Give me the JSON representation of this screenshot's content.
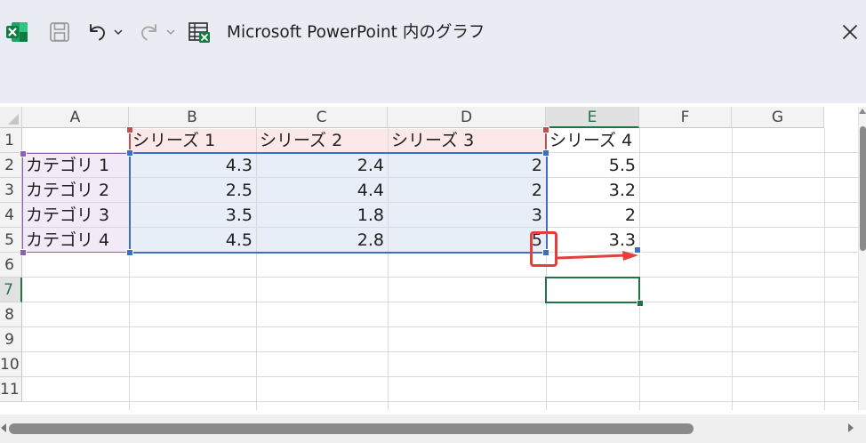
{
  "window": {
    "title": "Microsoft PowerPoint 内のグラフ",
    "icons": {
      "app": "excel-icon",
      "save": "save-icon",
      "undo": "undo-icon",
      "undo_dropdown": "chevron-down-icon",
      "redo": "redo-icon",
      "redo_dropdown": "chevron-down-icon",
      "edit_in_excel": "excel-sheet-icon",
      "close": "close-icon"
    }
  },
  "sheet": {
    "columns": [
      "A",
      "B",
      "C",
      "D",
      "E",
      "F",
      "G"
    ],
    "active_column": "E",
    "rows": [
      "1",
      "2",
      "3",
      "4",
      "5",
      "6",
      "7",
      "8",
      "9",
      "10",
      "11"
    ],
    "active_row": "7",
    "header_row": [
      "",
      "シリーズ 1",
      "シリーズ 2",
      "シリーズ 3",
      "シリーズ 4"
    ],
    "data_rows": [
      [
        "カテゴリ 1",
        "4.3",
        "2.4",
        "2",
        "5.5"
      ],
      [
        "カテゴリ 2",
        "2.5",
        "4.4",
        "2",
        "3.2"
      ],
      [
        "カテゴリ 3",
        "3.5",
        "1.8",
        "3",
        "2"
      ],
      [
        "カテゴリ 4",
        "4.5",
        "2.8",
        "5",
        "3.3"
      ]
    ],
    "active_cell": "E7",
    "colors": {
      "series_range": "#c0504d",
      "category_range": "#8e5fb5",
      "value_range": "#3a6fc4",
      "active_cell": "#217346",
      "annotation": "#e2403a"
    }
  }
}
